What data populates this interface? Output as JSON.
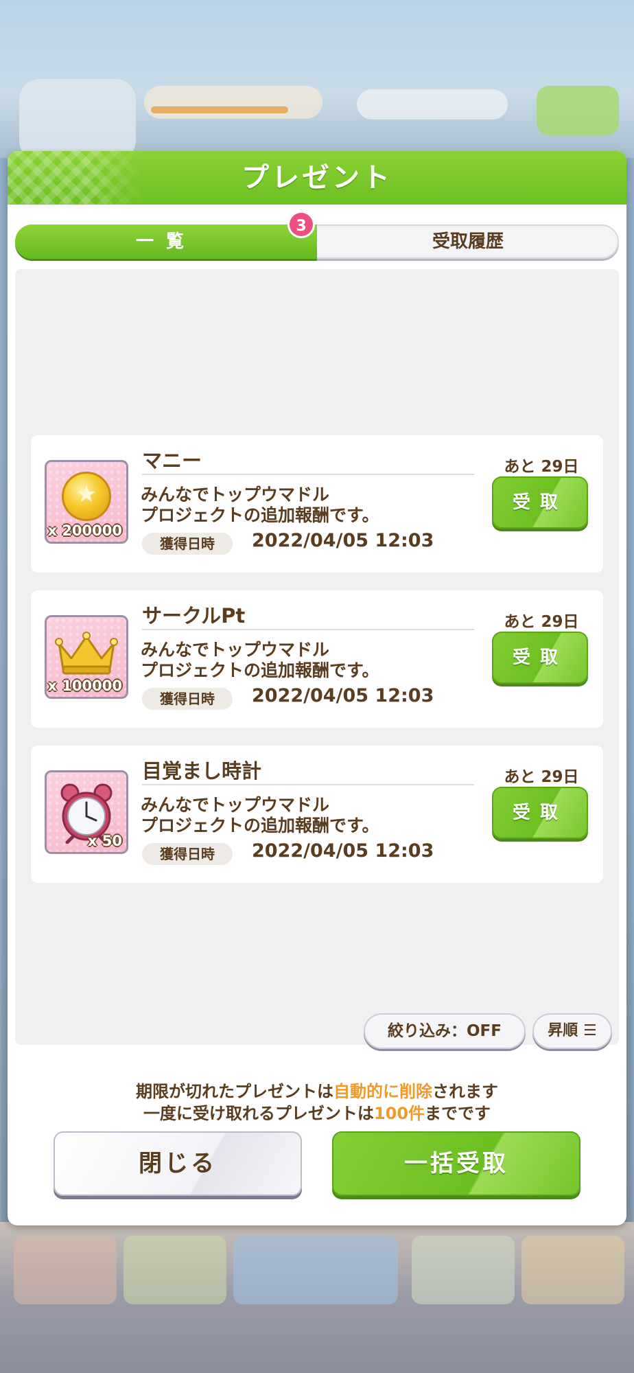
{
  "dialog": {
    "title": "プレゼント"
  },
  "tabs": {
    "list_label": "一覧",
    "history_label": "受取履歴",
    "badge_count": "3"
  },
  "items": [
    {
      "name": "マニー",
      "icon": "money-coin-icon",
      "quantity": "x 200000",
      "description_line1": "みんなでトップウマドル",
      "description_line2": "プロジェクトの追加報酬です。",
      "date_label": "獲得日時",
      "date": "2022/04/05 12:03",
      "remaining": "あと 29日",
      "receive_label": "受取"
    },
    {
      "name": "サークルPt",
      "icon": "crown-icon",
      "quantity": "x 100000",
      "description_line1": "みんなでトップウマドル",
      "description_line2": "プロジェクトの追加報酬です。",
      "date_label": "獲得日時",
      "date": "2022/04/05 12:03",
      "remaining": "あと 29日",
      "receive_label": "受取"
    },
    {
      "name": "目覚まし時計",
      "icon": "alarm-clock-icon",
      "quantity": "x 50",
      "description_line1": "みんなでトップウマドル",
      "description_line2": "プロジェクトの追加報酬です。",
      "date_label": "獲得日時",
      "date": "2022/04/05 12:03",
      "remaining": "あと 29日",
      "receive_label": "受取"
    }
  ],
  "controls": {
    "filter_label": "絞り込み：OFF",
    "sort_label": "昇順 ☰"
  },
  "notice": {
    "line1_pre": "期限が切れたプレゼントは",
    "line1_highlight": "自動的に削除",
    "line1_post": "されます",
    "line2_pre": "一度に受け取れるプレゼントは",
    "line2_highlight": "100件",
    "line2_post": "までです"
  },
  "footer": {
    "close_label": "閉じる",
    "bulk_receive_label": "一括受取"
  },
  "colors": {
    "accent_green": "#6cc022",
    "text_brown": "#5a3c1e",
    "badge_pink": "#ec4f80",
    "highlight_orange": "#f09a2b"
  }
}
